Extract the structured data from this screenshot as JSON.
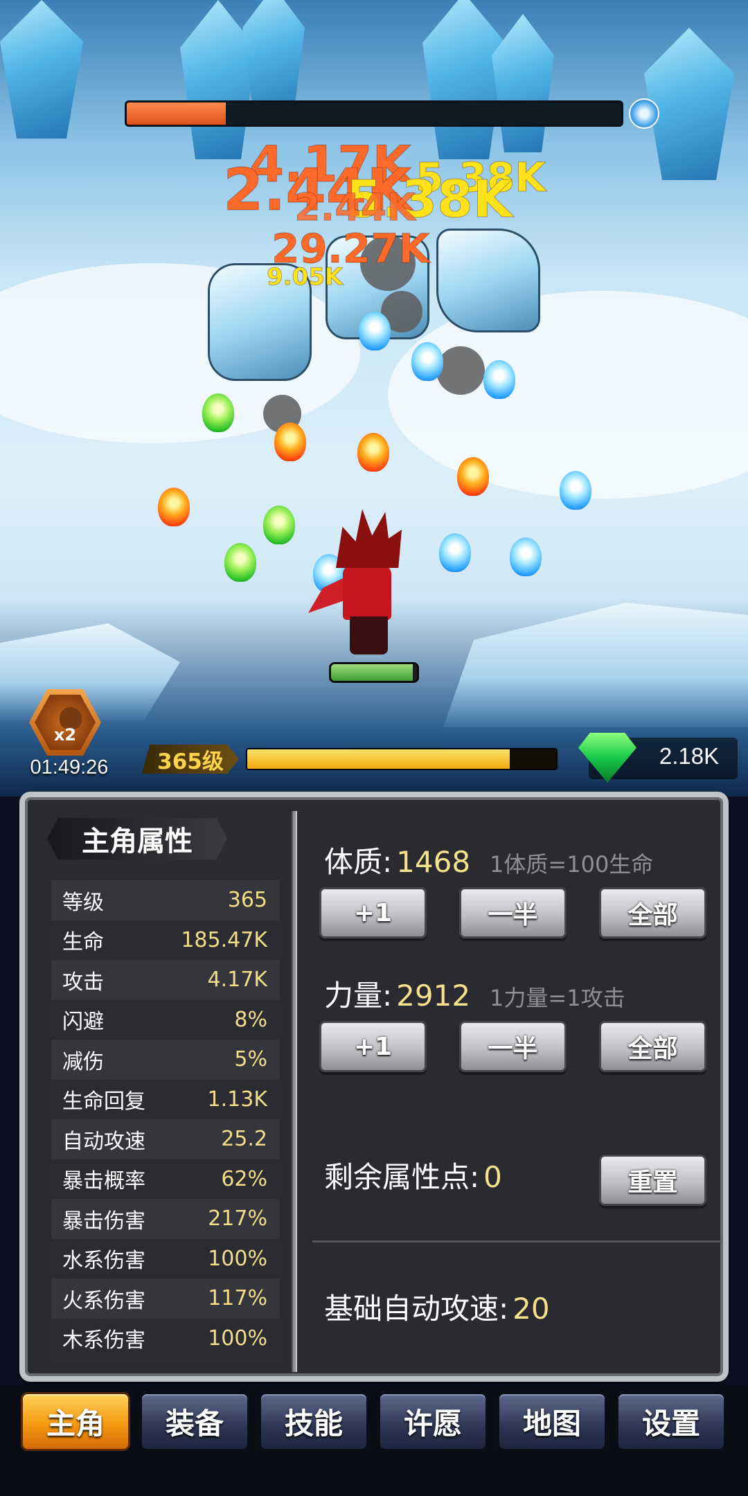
{
  "battle": {
    "boss_hp_fraction": 0.2,
    "hero_hp_fraction": 0.95,
    "damage_numbers": [
      {
        "text": "4.17K",
        "color": "orange"
      },
      {
        "text": "2.44K",
        "color": "orange"
      },
      {
        "text": "5.38K",
        "color": "yellow"
      },
      {
        "text": "5.38K",
        "color": "yellow"
      },
      {
        "text": "2.44K",
        "color": "orange"
      },
      {
        "text": "29.27K",
        "color": "orange"
      },
      {
        "text": "9.05K",
        "color": "yellow"
      }
    ]
  },
  "status": {
    "boost_multiplier": "x2",
    "boost_timer": "01:49:26",
    "level": "365级",
    "xp_fraction": 0.85,
    "gems": "2.18K"
  },
  "attributes": {
    "title": "主角属性",
    "stats": [
      {
        "label": "等级",
        "value": "365"
      },
      {
        "label": "生命",
        "value": "185.47K"
      },
      {
        "label": "攻击",
        "value": "4.17K"
      },
      {
        "label": "闪避",
        "value": "8%"
      },
      {
        "label": "减伤",
        "value": "5%"
      },
      {
        "label": "生命回复",
        "value": "1.13K"
      },
      {
        "label": "自动攻速",
        "value": "25.2"
      },
      {
        "label": "暴击概率",
        "value": "62%"
      },
      {
        "label": "暴击伤害",
        "value": "217%"
      },
      {
        "label": "水系伤害",
        "value": "100%"
      },
      {
        "label": "火系伤害",
        "value": "117%"
      },
      {
        "label": "木系伤害",
        "value": "100%"
      }
    ]
  },
  "allocation": {
    "constitution": {
      "label": "体质:",
      "value": "1468",
      "hint": "1体质=100生命"
    },
    "strength": {
      "label": "力量:",
      "value": "2912",
      "hint": "1力量=1攻击"
    },
    "buttons": {
      "plus_one": "+1",
      "half": "一半",
      "all": "全部"
    },
    "remaining": {
      "label": "剩余属性点:",
      "value": "0"
    },
    "reset_label": "重置",
    "base_speed": {
      "label": "基础自动攻速:",
      "value": "20"
    }
  },
  "nav": {
    "tabs": [
      {
        "label": "主角",
        "active": true
      },
      {
        "label": "装备",
        "active": false
      },
      {
        "label": "技能",
        "active": false
      },
      {
        "label": "许愿",
        "active": false
      },
      {
        "label": "地图",
        "active": false
      },
      {
        "label": "设置",
        "active": false
      }
    ]
  },
  "colors": {
    "accent_gold": "#f5e28c",
    "boss_hp": "#e0501b",
    "hero_hp": "#3e9e34",
    "xp": "#f2a90c",
    "active_tab": "#f59a12"
  }
}
